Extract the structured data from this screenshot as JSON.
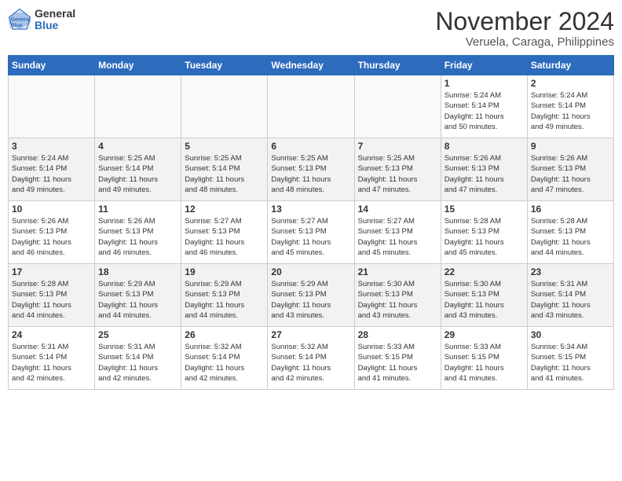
{
  "header": {
    "logo_general": "General",
    "logo_blue": "Blue",
    "title": "November 2024",
    "subtitle": "Veruela, Caraga, Philippines"
  },
  "weekdays": [
    "Sunday",
    "Monday",
    "Tuesday",
    "Wednesday",
    "Thursday",
    "Friday",
    "Saturday"
  ],
  "weeks": [
    [
      {
        "day": "",
        "info": ""
      },
      {
        "day": "",
        "info": ""
      },
      {
        "day": "",
        "info": ""
      },
      {
        "day": "",
        "info": ""
      },
      {
        "day": "",
        "info": ""
      },
      {
        "day": "1",
        "info": "Sunrise: 5:24 AM\nSunset: 5:14 PM\nDaylight: 11 hours\nand 50 minutes."
      },
      {
        "day": "2",
        "info": "Sunrise: 5:24 AM\nSunset: 5:14 PM\nDaylight: 11 hours\nand 49 minutes."
      }
    ],
    [
      {
        "day": "3",
        "info": "Sunrise: 5:24 AM\nSunset: 5:14 PM\nDaylight: 11 hours\nand 49 minutes."
      },
      {
        "day": "4",
        "info": "Sunrise: 5:25 AM\nSunset: 5:14 PM\nDaylight: 11 hours\nand 49 minutes."
      },
      {
        "day": "5",
        "info": "Sunrise: 5:25 AM\nSunset: 5:14 PM\nDaylight: 11 hours\nand 48 minutes."
      },
      {
        "day": "6",
        "info": "Sunrise: 5:25 AM\nSunset: 5:13 PM\nDaylight: 11 hours\nand 48 minutes."
      },
      {
        "day": "7",
        "info": "Sunrise: 5:25 AM\nSunset: 5:13 PM\nDaylight: 11 hours\nand 47 minutes."
      },
      {
        "day": "8",
        "info": "Sunrise: 5:26 AM\nSunset: 5:13 PM\nDaylight: 11 hours\nand 47 minutes."
      },
      {
        "day": "9",
        "info": "Sunrise: 5:26 AM\nSunset: 5:13 PM\nDaylight: 11 hours\nand 47 minutes."
      }
    ],
    [
      {
        "day": "10",
        "info": "Sunrise: 5:26 AM\nSunset: 5:13 PM\nDaylight: 11 hours\nand 46 minutes."
      },
      {
        "day": "11",
        "info": "Sunrise: 5:26 AM\nSunset: 5:13 PM\nDaylight: 11 hours\nand 46 minutes."
      },
      {
        "day": "12",
        "info": "Sunrise: 5:27 AM\nSunset: 5:13 PM\nDaylight: 11 hours\nand 46 minutes."
      },
      {
        "day": "13",
        "info": "Sunrise: 5:27 AM\nSunset: 5:13 PM\nDaylight: 11 hours\nand 45 minutes."
      },
      {
        "day": "14",
        "info": "Sunrise: 5:27 AM\nSunset: 5:13 PM\nDaylight: 11 hours\nand 45 minutes."
      },
      {
        "day": "15",
        "info": "Sunrise: 5:28 AM\nSunset: 5:13 PM\nDaylight: 11 hours\nand 45 minutes."
      },
      {
        "day": "16",
        "info": "Sunrise: 5:28 AM\nSunset: 5:13 PM\nDaylight: 11 hours\nand 44 minutes."
      }
    ],
    [
      {
        "day": "17",
        "info": "Sunrise: 5:28 AM\nSunset: 5:13 PM\nDaylight: 11 hours\nand 44 minutes."
      },
      {
        "day": "18",
        "info": "Sunrise: 5:29 AM\nSunset: 5:13 PM\nDaylight: 11 hours\nand 44 minutes."
      },
      {
        "day": "19",
        "info": "Sunrise: 5:29 AM\nSunset: 5:13 PM\nDaylight: 11 hours\nand 44 minutes."
      },
      {
        "day": "20",
        "info": "Sunrise: 5:29 AM\nSunset: 5:13 PM\nDaylight: 11 hours\nand 43 minutes."
      },
      {
        "day": "21",
        "info": "Sunrise: 5:30 AM\nSunset: 5:13 PM\nDaylight: 11 hours\nand 43 minutes."
      },
      {
        "day": "22",
        "info": "Sunrise: 5:30 AM\nSunset: 5:13 PM\nDaylight: 11 hours\nand 43 minutes."
      },
      {
        "day": "23",
        "info": "Sunrise: 5:31 AM\nSunset: 5:14 PM\nDaylight: 11 hours\nand 43 minutes."
      }
    ],
    [
      {
        "day": "24",
        "info": "Sunrise: 5:31 AM\nSunset: 5:14 PM\nDaylight: 11 hours\nand 42 minutes."
      },
      {
        "day": "25",
        "info": "Sunrise: 5:31 AM\nSunset: 5:14 PM\nDaylight: 11 hours\nand 42 minutes."
      },
      {
        "day": "26",
        "info": "Sunrise: 5:32 AM\nSunset: 5:14 PM\nDaylight: 11 hours\nand 42 minutes."
      },
      {
        "day": "27",
        "info": "Sunrise: 5:32 AM\nSunset: 5:14 PM\nDaylight: 11 hours\nand 42 minutes."
      },
      {
        "day": "28",
        "info": "Sunrise: 5:33 AM\nSunset: 5:15 PM\nDaylight: 11 hours\nand 41 minutes."
      },
      {
        "day": "29",
        "info": "Sunrise: 5:33 AM\nSunset: 5:15 PM\nDaylight: 11 hours\nand 41 minutes."
      },
      {
        "day": "30",
        "info": "Sunrise: 5:34 AM\nSunset: 5:15 PM\nDaylight: 11 hours\nand 41 minutes."
      }
    ]
  ]
}
